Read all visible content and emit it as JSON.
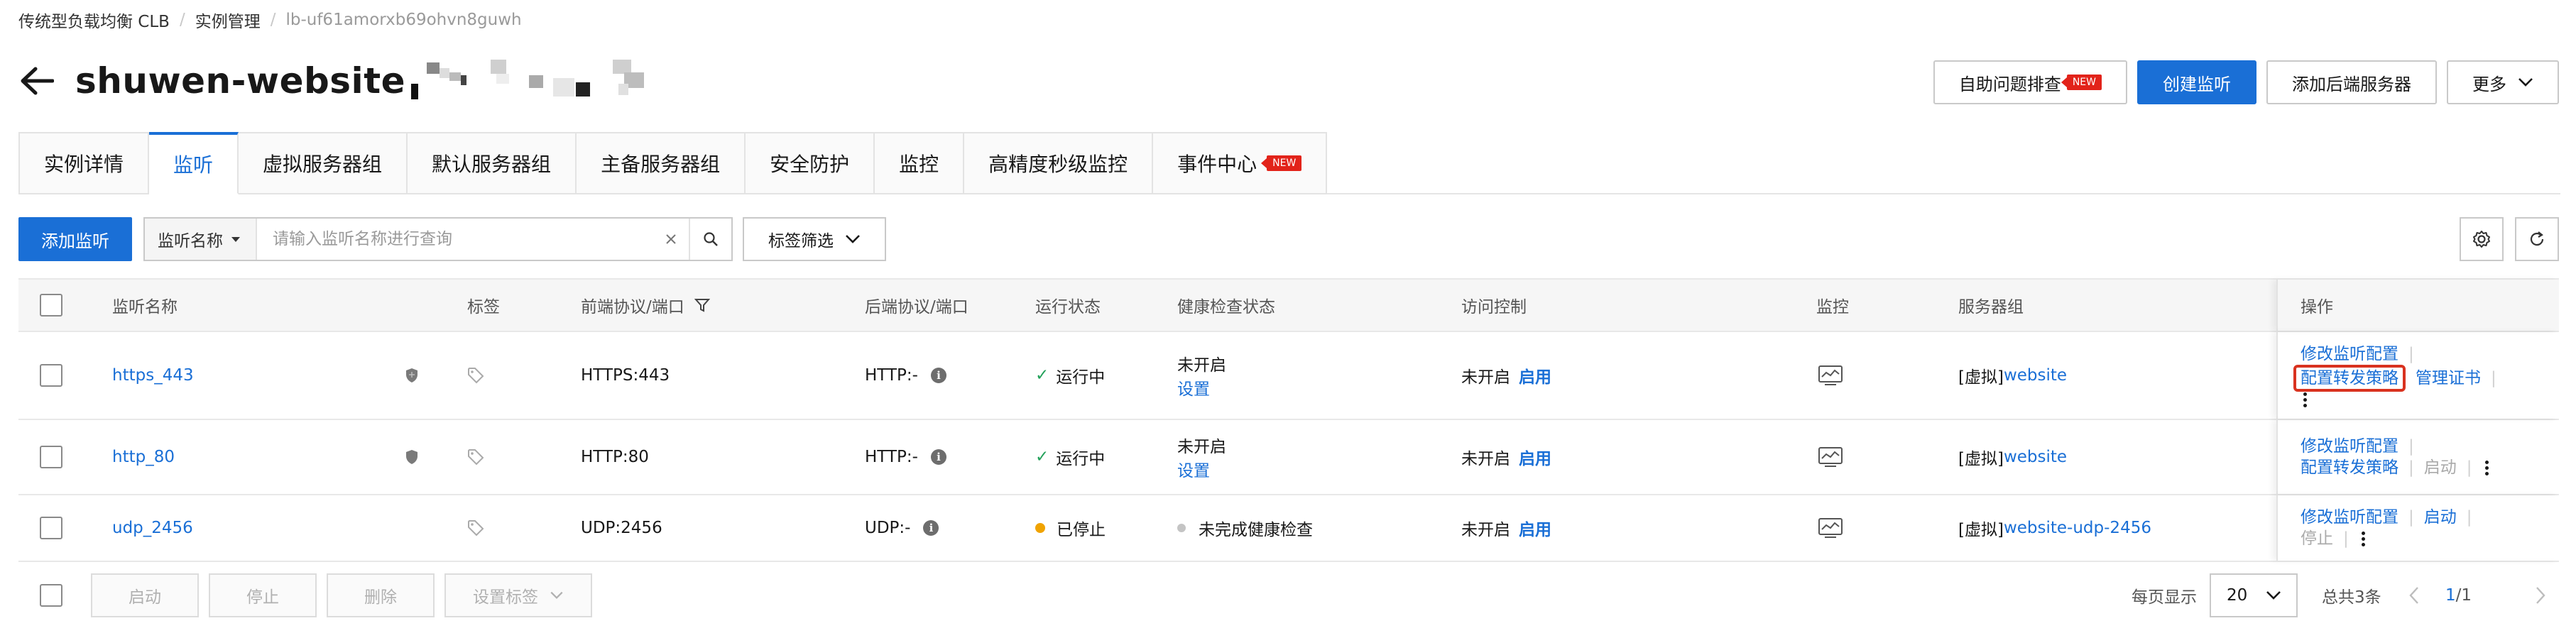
{
  "breadcrumb": {
    "items": [
      "传统型负载均衡 CLB",
      "实例管理",
      "lb-uf61amorxb69ohvn8guwh"
    ],
    "separator": "/"
  },
  "page": {
    "title": "shuwen-website"
  },
  "header_actions": {
    "self_diagnose": "自助问题排查",
    "new_badge": "NEW",
    "create_listener": "创建监听",
    "add_backend": "添加后端服务器",
    "more": "更多"
  },
  "tabs": [
    {
      "label": "实例详情",
      "active": false
    },
    {
      "label": "监听",
      "active": true
    },
    {
      "label": "虚拟服务器组",
      "active": false
    },
    {
      "label": "默认服务器组",
      "active": false
    },
    {
      "label": "主备服务器组",
      "active": false
    },
    {
      "label": "安全防护",
      "active": false
    },
    {
      "label": "监控",
      "active": false
    },
    {
      "label": "高精度秒级监控",
      "active": false
    },
    {
      "label": "事件中心",
      "active": false,
      "badge": "NEW"
    }
  ],
  "toolbar": {
    "add_listener": "添加监听",
    "search_field": "监听名称",
    "search_placeholder": "请输入监听名称进行查询",
    "tag_filter": "标签筛选"
  },
  "table": {
    "columns": {
      "name": "监听名称",
      "tag": "标签",
      "frontend": "前端协议/端口",
      "backend": "后端协议/端口",
      "status": "运行状态",
      "health": "健康检查状态",
      "acl": "访问控制",
      "monitor": "监控",
      "server_group": "服务器组",
      "actions": "操作"
    },
    "rows": [
      {
        "name": "https_443",
        "frontend": "HTTPS:443",
        "backend": "HTTP:-",
        "status": "运行中",
        "health_line1": "未开启",
        "health_link": "设置",
        "acl_status": "未开启",
        "acl_action": "启用",
        "server_group_prefix": "[虚拟]",
        "server_group_name": "website",
        "op_modify": "修改监听配置",
        "op_forward": "配置转发策略",
        "op_cert": "管理证书"
      },
      {
        "name": "http_80",
        "frontend": "HTTP:80",
        "backend": "HTTP:-",
        "status": "运行中",
        "health_line1": "未开启",
        "health_link": "设置",
        "acl_status": "未开启",
        "acl_action": "启用",
        "server_group_prefix": "[虚拟]",
        "server_group_name": "website",
        "op_modify": "修改监听配置",
        "op_forward": "配置转发策略",
        "op_start": "启动"
      },
      {
        "name": "udp_2456",
        "frontend": "UDP:2456",
        "backend": "UDP:-",
        "status": "已停止",
        "health_line1": "未完成健康检查",
        "acl_status": "未开启",
        "acl_action": "启用",
        "server_group_prefix": "[虚拟]",
        "server_group_name": "website-udp-2456",
        "op_modify": "修改监听配置",
        "op_start": "启动",
        "op_stop": "停止"
      }
    ]
  },
  "footer": {
    "start": "启动",
    "stop": "停止",
    "delete": "删除",
    "set_tags": "设置标签",
    "per_page_label": "每页显示",
    "per_page_value": "20",
    "total": "总共3条",
    "page_current": "1",
    "page_total": "/1"
  },
  "colors": {
    "accent": "#1a6fd6",
    "highlight_box": "#d9321f",
    "running": "#23a15a",
    "stopped": "#f0a300",
    "badge": "#e2231a"
  }
}
